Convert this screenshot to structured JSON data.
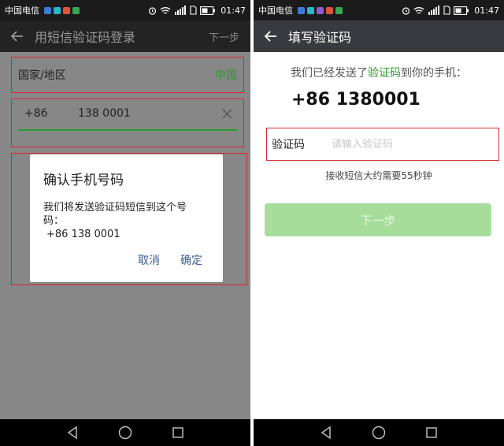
{
  "status_bar": {
    "carrier": "中国电信",
    "time": "01:47"
  },
  "left_screen": {
    "appbar": {
      "title": "用短信验证码登录",
      "action": "下一步"
    },
    "country": {
      "label": "国家/地区",
      "value": "中国"
    },
    "phone": {
      "code": "+86",
      "number": "138 0001"
    },
    "dialog": {
      "title": "确认手机号码",
      "body_line1": "我们将发送验证码短信到这个号",
      "body_line2": "码：",
      "phone": "+86 138 0001",
      "cancel": "取消",
      "confirm": "确定"
    }
  },
  "right_screen": {
    "appbar": {
      "title": "填写验证码"
    },
    "sent_prefix": "我们已经发送了",
    "sent_highlight": "验证码",
    "sent_suffix": "到你的手机：",
    "phone": "+86 1380001",
    "code_label": "验证码",
    "code_placeholder": "请输入验证码",
    "hint": "接收短信大约需要55秒钟",
    "next_button": "下一步"
  },
  "colors": {
    "accent_green": "#2b9a2a",
    "highlight_red": "#d9262f",
    "button_green": "#a6dd9b"
  },
  "icons": [
    "back-arrow-icon",
    "clear-icon",
    "nav-back-icon",
    "nav-home-icon",
    "nav-recents-icon",
    "alarm-icon",
    "wifi-icon",
    "signal-icon",
    "battery-icon"
  ]
}
